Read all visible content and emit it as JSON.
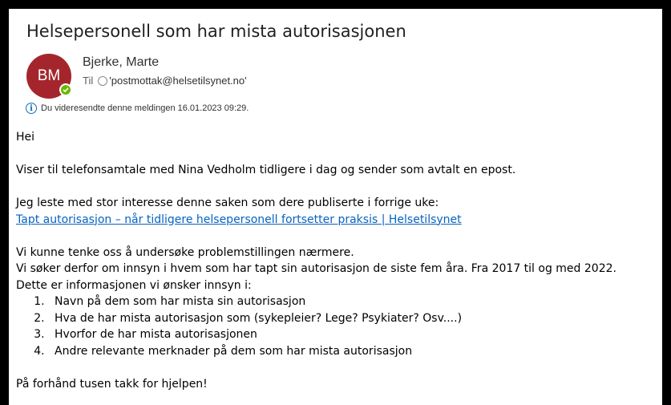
{
  "email": {
    "subject": "Helsepersonell som har mista autorisasjonen",
    "sender": {
      "initials": "BM",
      "name": "Bjerke, Marte",
      "avatar_color": "#a4262c",
      "presence_color": "#6bb700"
    },
    "to_label": "Til",
    "to_address": "'postmottak@helsetilsynet.no'",
    "info_text": "Du videresendte denne meldingen 16.01.2023 09:29.",
    "body": {
      "greeting": "Hei",
      "p1": "Viser til telefonsamtale med Nina Vedholm tidligere i dag og sender som avtalt en epost.",
      "p2": "Jeg leste med stor interesse denne saken som dere publiserte i forrige uke:",
      "link": "Tapt autorisasjon – når tidligere helsepersonell fortsetter praksis | Helsetilsynet",
      "p3": "Vi kunne tenke oss å undersøke problemstillingen nærmere.",
      "p4": "Vi søker derfor om innsyn i hvem som har tapt sin autorisasjon de siste fem åra. Fra 2017 til og med 2022.",
      "p5": "Dette er informasjonen vi ønsker innsyn i:",
      "list": [
        "Navn på dem som har mista sin autorisasjon",
        "Hva de har mista autorisasjon som (sykepleier? Lege? Psykiater? Osv....)",
        "Hvorfor de har mista autorisasjonen",
        "Andre relevante merknader på dem som har mista autorisasjon"
      ],
      "closing": "På forhånd tusen takk for hjelpen!"
    }
  }
}
